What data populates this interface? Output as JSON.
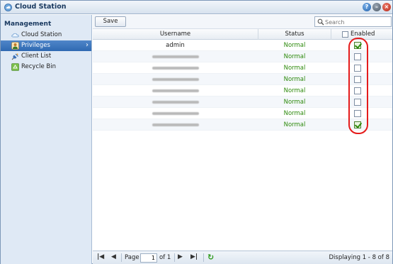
{
  "window": {
    "title": "Cloud Station",
    "help_label": "?",
    "min_label": "–",
    "close_label": "×"
  },
  "sidebar": {
    "heading": "Management",
    "items": [
      {
        "label": "Cloud Station",
        "icon": "cloud-icon",
        "active": false
      },
      {
        "label": "Privileges",
        "icon": "user-icon",
        "active": true
      },
      {
        "label": "Client List",
        "icon": "satellite-icon",
        "active": false
      },
      {
        "label": "Recycle Bin",
        "icon": "recycle-bin-icon",
        "active": false
      }
    ]
  },
  "toolbar": {
    "save_label": "Save",
    "search_placeholder": "Search"
  },
  "grid": {
    "columns": [
      "Username",
      "Status",
      "Enabled"
    ],
    "rows": [
      {
        "username": "admin",
        "status": "Normal",
        "enabled": true
      },
      {
        "username": "",
        "status": "Normal",
        "enabled": false
      },
      {
        "username": "",
        "status": "Normal",
        "enabled": false
      },
      {
        "username": "",
        "status": "Normal",
        "enabled": false
      },
      {
        "username": "",
        "status": "Normal",
        "enabled": false
      },
      {
        "username": "",
        "status": "Normal",
        "enabled": false
      },
      {
        "username": "",
        "status": "Normal",
        "enabled": false
      },
      {
        "username": "",
        "status": "Normal",
        "enabled": true
      }
    ]
  },
  "pager": {
    "first": "|◀",
    "prev": "◀",
    "page_label": "Page",
    "page_value": "1",
    "of_label": "of 1",
    "next": "▶",
    "last": "▶|",
    "refresh": "↻",
    "displaying": "Displaying 1 - 8 of 8"
  },
  "colors": {
    "status": "#2d8a0c",
    "highlight": "#e51b1b",
    "active_nav": "#3a74bd"
  }
}
